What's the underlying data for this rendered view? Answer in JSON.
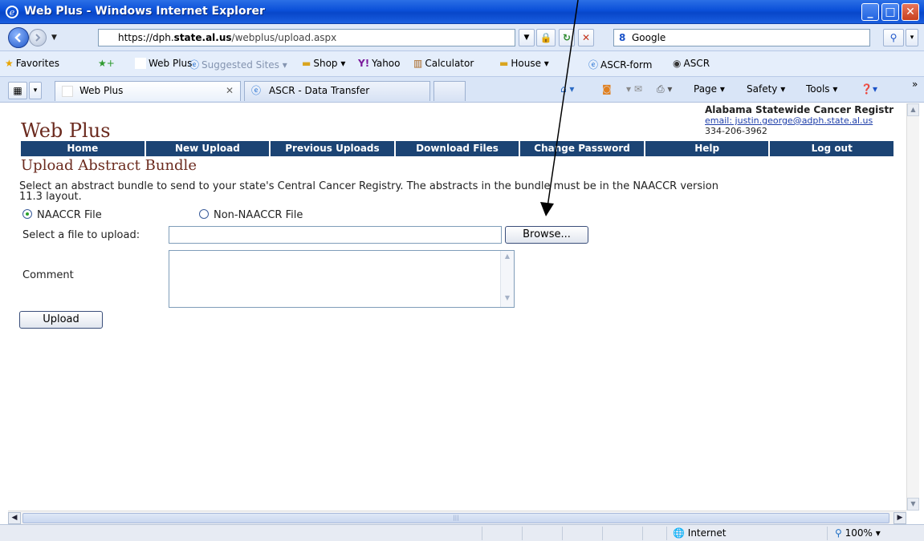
{
  "window": {
    "title": "Web Plus - Windows Internet Explorer"
  },
  "address_bar": {
    "url_prefix": "https://dph.",
    "url_domain": "state.al.us",
    "url_path": "/webplus/upload.aspx",
    "search_engine": "Google"
  },
  "favorites_bar": {
    "favorites_label": "Favorites",
    "items": [
      "Web Plus",
      "Suggested Sites ▾",
      "Shop ▾",
      "Yahoo",
      "Calculator",
      "House ▾",
      "ASCR-form",
      "ASCR"
    ]
  },
  "tabs": [
    {
      "label": "Web Plus",
      "active": true
    },
    {
      "label": "ASCR - Data Transfer",
      "active": false
    }
  ],
  "command_bar": {
    "page": "Page ▾",
    "safety": "Safety ▾",
    "tools": "Tools ▾"
  },
  "page": {
    "site_title": "Web Plus",
    "org_name": "Alabama Statewide Cancer Registr",
    "org_email": "email: justin.george@adph.state.al.us",
    "org_phone": "334-206-3962",
    "menu": [
      "Home",
      "New Upload",
      "Previous Uploads",
      "Download Files",
      "Change Password",
      "Help",
      "Log out"
    ],
    "heading": "Upload Abstract Bundle",
    "instructions": "Select an abstract bundle to send to your state's Central Cancer Registry. The abstracts in the bundle must be in the NAACCR version 11.3 layout.",
    "radio_options": [
      {
        "label": "NAACCR File",
        "selected": true
      },
      {
        "label": "Non-NAACCR File",
        "selected": false
      }
    ],
    "file_label": "Select a file to upload:",
    "file_value": "",
    "browse_label": "Browse...",
    "comment_label": "Comment",
    "comment_value": "",
    "upload_label": "Upload"
  },
  "status_bar": {
    "zone": "Internet",
    "zoom": "100%"
  }
}
